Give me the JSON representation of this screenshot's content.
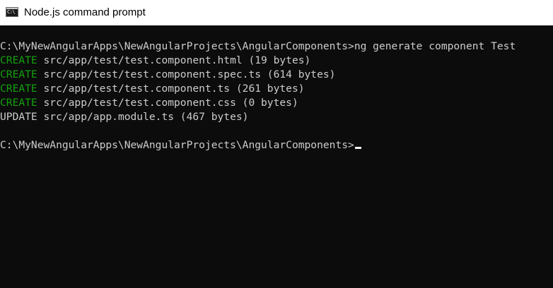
{
  "window": {
    "title": "Node.js command prompt",
    "icon": "cmd-console-icon",
    "icon_label": "C:\\"
  },
  "console": {
    "colors": {
      "background": "#0c0c0c",
      "text": "#cccccc",
      "create": "#13a10e",
      "cursor": "#f2f2f2"
    },
    "prompt_command": {
      "prompt": "C:\\MyNewAngularApps\\NewAngularProjects\\AngularComponents>",
      "command": "ng generate component Test"
    },
    "output": [
      {
        "action": "CREATE",
        "text": " src/app/test/test.component.html (19 bytes)"
      },
      {
        "action": "CREATE",
        "text": " src/app/test/test.component.spec.ts (614 bytes)"
      },
      {
        "action": "CREATE",
        "text": " src/app/test/test.component.ts (261 bytes)"
      },
      {
        "action": "CREATE",
        "text": " src/app/test/test.component.css (0 bytes)"
      },
      {
        "action": "UPDATE",
        "text": " src/app/app.module.ts (467 bytes)"
      }
    ],
    "current_prompt": "C:\\MyNewAngularApps\\NewAngularProjects\\AngularComponents>"
  }
}
